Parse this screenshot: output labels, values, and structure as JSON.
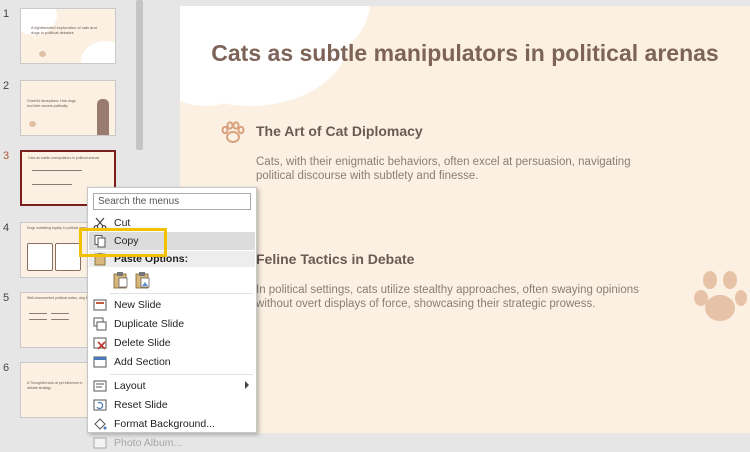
{
  "thumbnails": {
    "numbers": [
      "1",
      "2",
      "3",
      "4",
      "5",
      "6"
    ],
    "slide1_title": "A lighthearted exploration of cats and dogs in political debates",
    "slide2_title": "Cheerful deceptions: How dogs fool their owners politically",
    "slide3_title": "Cats as subtle manipulators in political arenas",
    "slide4_title": "Dogs outwitting loyalty in political arenas",
    "slide5_title": "Well-documented political antics, dog feline",
    "slide6_title": "A Thoughtful look at pet influence in debate strategy"
  },
  "slide": {
    "title": "Cats as subtle manipulators in political arenas",
    "section1_heading": "The Art of Cat Diplomacy",
    "section1_body": "Cats, with their enigmatic behaviors, often excel at persuasion, navigating political discourse with subtlety and finesse.",
    "section2_heading": "Feline Tactics in Debate",
    "section2_body": "In political settings, cats utilize stealthy approaches, often swaying opinions without overt displays of force, showcasing their strategic prowess."
  },
  "context_menu": {
    "search_placeholder": "Search the menus",
    "cut": "Cut",
    "copy": "Copy",
    "paste_options": "Paste Options:",
    "new_slide": "New Slide",
    "duplicate_slide": "Duplicate Slide",
    "delete_slide": "Delete Slide",
    "add_section": "Add Section",
    "layout": "Layout",
    "reset_slide": "Reset Slide",
    "format_background": "Format Background...",
    "photo_album": "Photo Album..."
  },
  "colors": {
    "slide_bg": "#fbf0e1",
    "title": "#7d6358",
    "highlight_box": "#f2c200",
    "selected_thumb_border": "#7a1e1e"
  }
}
